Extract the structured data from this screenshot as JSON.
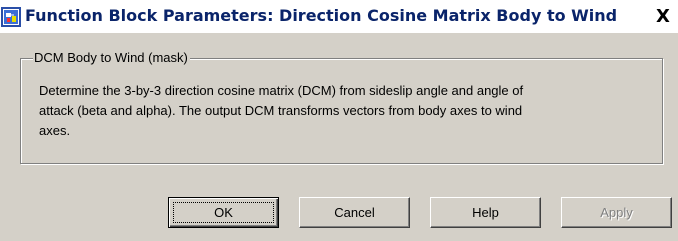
{
  "window": {
    "title": "Function Block Parameters: Direction Cosine Matrix Body to Wind",
    "close_label": "X",
    "icon": "simulink-block-icon"
  },
  "group": {
    "legend": "DCM Body to Wind (mask)",
    "description_lines": [
      "Determine the 3-by-3 direction cosine matrix (DCM) from sideslip angle and angle of",
      "attack (beta and alpha). The output DCM transforms vectors from body axes to wind",
      "axes."
    ]
  },
  "buttons": {
    "ok": "OK",
    "cancel": "Cancel",
    "help": "Help",
    "apply": "Apply"
  },
  "colors": {
    "title_text": "#0a246a",
    "dialog_background": "#d4d0c8",
    "disabled_text": "#808080"
  }
}
